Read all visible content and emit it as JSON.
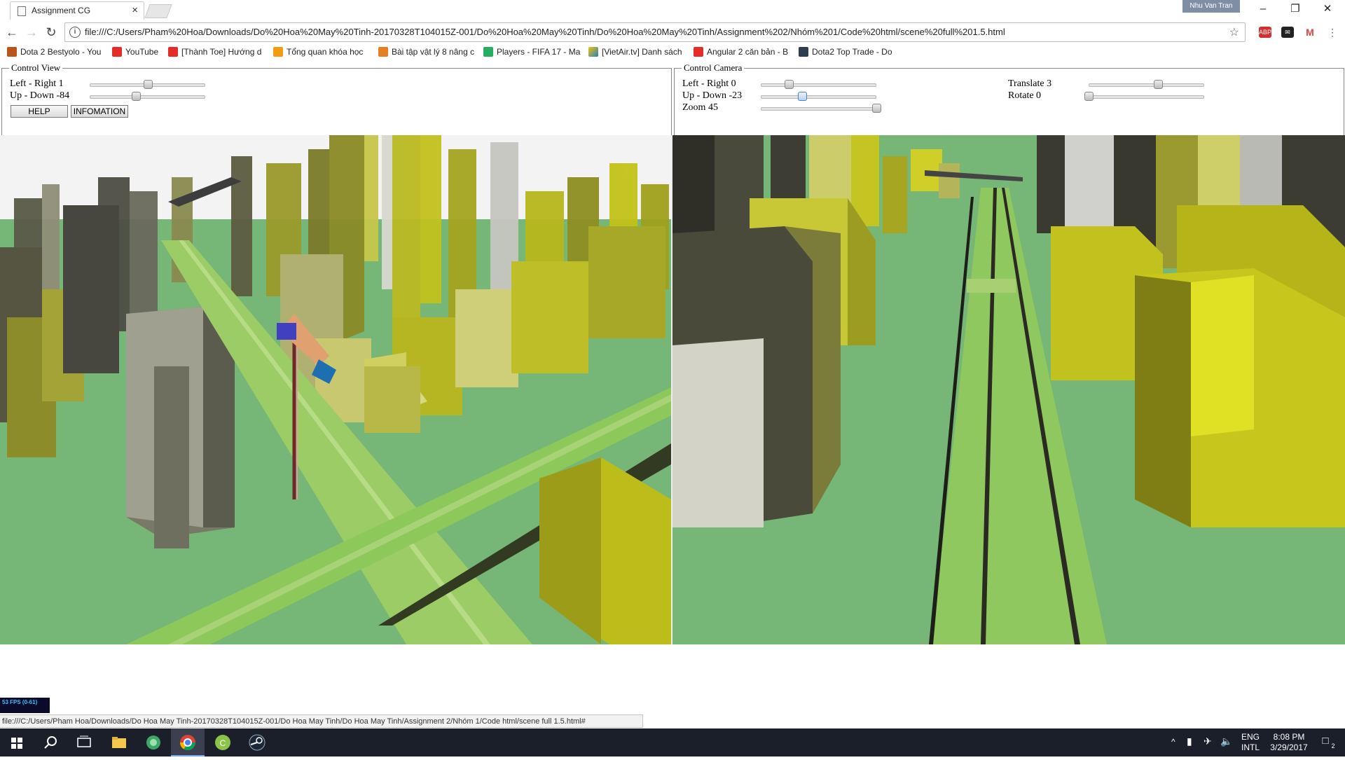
{
  "browser": {
    "tab_title": "Assignment CG",
    "user_name": "Nhu Van Tran",
    "url": "file:///C:/Users/Pham%20Hoa/Downloads/Do%20Hoa%20May%20Tinh-20170328T104015Z-001/Do%20Hoa%20May%20Tinh/Do%20Hoa%20May%20Tinh/Assignment%202/Nhóm%201/Code%20html/scene%20full%201.5.html",
    "extensions": [
      "ABP",
      "mail-icon",
      "gmail-icon"
    ],
    "bookmarks": [
      {
        "label": "Dota 2 Bestyolo - You",
        "icon": "dota-icon",
        "color": "#c0392b"
      },
      {
        "label": "YouTube",
        "icon": "youtube-icon",
        "color": "#e52d27"
      },
      {
        "label": "[Thành Toe] Hướng d",
        "icon": "youtube-icon",
        "color": "#e52d27"
      },
      {
        "label": "Tổng quan khóa học",
        "icon": "udemy-icon",
        "color": "#f39c12"
      },
      {
        "label": "Bài tập vật lý 8 nâng c",
        "icon": "123-icon",
        "color": "#e67e22"
      },
      {
        "label": "Players - FIFA 17 - Ma",
        "icon": "fifa-icon",
        "color": "#27ae60"
      },
      {
        "label": "[VietAir.tv] Danh sách",
        "icon": "vietair-icon",
        "color": "#f1c40f"
      },
      {
        "label": "Angular 2 căn bản - B",
        "icon": "youtube-icon",
        "color": "#e52d27"
      },
      {
        "label": "Dota2 Top Trade - Do",
        "icon": "dota-icon",
        "color": "#2c3e50"
      }
    ]
  },
  "control_view": {
    "legend": "Control View",
    "left_right_label": "Left - Right 1",
    "up_down_label": "Up - Down -84",
    "left_right_value": 0.5,
    "up_down_value": 0.4,
    "help_label": "HELP",
    "info_label": "INFOMATION"
  },
  "control_camera": {
    "legend": "Control Camera",
    "left_right_label": "Left - Right 0",
    "up_down_label": "Up - Down -23",
    "zoom_label": "Zoom 45",
    "translate_label": "Translate 3",
    "rotate_label": "Rotate 0",
    "left_right_value": 0.24,
    "up_down_value": 0.36,
    "zoom_value": 1.0,
    "translate_value": 0.6,
    "rotate_value": 0.0
  },
  "fps_label": "53 FPS (0-61)",
  "status_url": "file:///C:/Users/Pham Hoa/Downloads/Do Hoa May Tinh-20170328T104015Z-001/Do Hoa May Tinh/Do Hoa May Tinh/Assignment 2/Nhóm 1/Code html/scene full 1.5.html#",
  "taskbar": {
    "language": "ENG",
    "layout": "INTL",
    "time": "8:08 PM",
    "date": "3/29/2017",
    "notification_count": "2"
  },
  "colors": {
    "ground": "#74b673",
    "road": "#8cc85a",
    "building_yellow": "#c8c820",
    "building_olive": "#9a9a30",
    "building_gray": "#a8a8a0",
    "building_dark": "#3a3a30"
  }
}
